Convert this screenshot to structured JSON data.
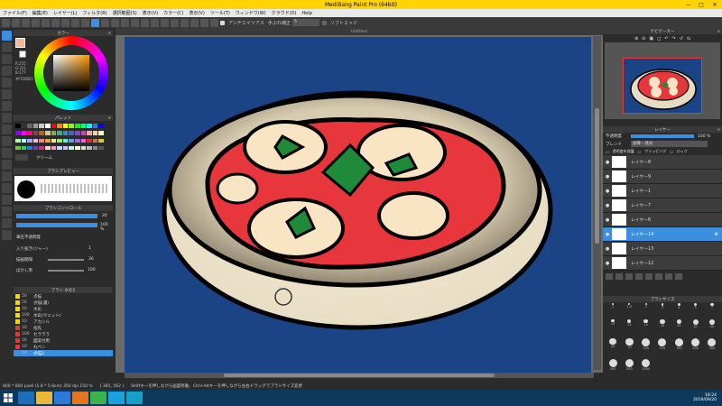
{
  "window": {
    "title": "MediBang Paint Pro (64bit)",
    "minimize": "—",
    "maximize": "□",
    "close": "✕"
  },
  "menu": [
    "ファイル(F)",
    "編集(E)",
    "レイヤー(L)",
    "フィルタ(R)",
    "選択範囲(S)",
    "表示(V)",
    "カラー(C)",
    "表示(V)",
    "ツール(T)",
    "ウィンドウ(W)",
    "クラウド(D)",
    "Help"
  ],
  "toolbar": {
    "antialias_label": "アンチエイリアス",
    "correction_label": "手ぶれ補正",
    "correction_value": "5",
    "soft_edge_label": "ソフトエッジ"
  },
  "color_panel": {
    "title": "カラー",
    "rgb": [
      "R:255",
      "G:221",
      "B:177"
    ],
    "hex": "#FFDDB1"
  },
  "palette_panel": {
    "title": "パレット",
    "palette_name": "クリーム"
  },
  "brush_preview": {
    "title": "ブラシプレビュー"
  },
  "brush_control": {
    "title": "ブラシコントロール",
    "size_value": "26",
    "opacity_value": "100 %",
    "opts": [
      {
        "label": "筆圧不透明度",
        "value": ""
      },
      {
        "label": "入り抜き(ジャー)",
        "value": "1"
      },
      {
        "label": "描画間隔",
        "value": "36"
      },
      {
        "label": "ぼかし率",
        "value": "100"
      }
    ]
  },
  "brush_list": {
    "title": "ブラシ 水彩2",
    "items": [
      {
        "n": "50",
        "name": "点描",
        "color": "#ffd400"
      },
      {
        "n": "50",
        "name": "点描(濃)",
        "color": "#ffd400"
      },
      {
        "n": "10",
        "name": "水彩",
        "color": "#ffd400"
      },
      {
        "n": "100",
        "name": "水彩(ウェット)",
        "color": "#ffd400"
      },
      {
        "n": "10",
        "name": "アカシル",
        "color": "#ffd400"
      },
      {
        "n": "10",
        "name": "指先",
        "color": "#e33"
      },
      {
        "n": "100",
        "name": "セラララ",
        "color": "#e33"
      },
      {
        "n": "16",
        "name": "図案付用",
        "color": "#e33"
      },
      {
        "n": "10",
        "name": "丸ペン",
        "color": "#e33"
      },
      {
        "n": "19",
        "name": "点描2",
        "color": "#3b8fe0"
      }
    ]
  },
  "canvas": {
    "tab": "Untitled"
  },
  "status": {
    "size": "800 * 800 pixel (5.8 * 5.8cm) 350 dpi 150 %",
    "coords": "( 381, 562 )",
    "hint": "Shiftキーを押しながら画面移動、Ctrl+Altキーを押しながら左右ドラッグでブラシサイズ変更"
  },
  "navigator": {
    "title": "ナビゲーター"
  },
  "layers_panel": {
    "title": "レイヤー",
    "opacity_label": "不透明度",
    "opacity_value": "100 %",
    "blend_label": "ブレンド",
    "blend_value": "加算・発光",
    "protect_label": "透明度を保護",
    "clipping_label": "クリッピング",
    "lock_label": "ロック",
    "layers": [
      {
        "name": "レイヤー8",
        "selected": false
      },
      {
        "name": "レイヤー9",
        "selected": false
      },
      {
        "name": "レイヤー1",
        "selected": false
      },
      {
        "name": "レイヤー7",
        "selected": false
      },
      {
        "name": "レイヤー6",
        "selected": false
      },
      {
        "name": "レイヤー14",
        "selected": true
      },
      {
        "name": "レイヤー13",
        "selected": false
      },
      {
        "name": "レイヤー12",
        "selected": false
      }
    ]
  },
  "brush_size": {
    "title": "ブラシサイズ",
    "sizes": [
      "1",
      "1.5",
      "2",
      "3",
      "4",
      "5",
      "7",
      "10",
      "12",
      "15",
      "20",
      "25",
      "30",
      "40",
      "50",
      "70",
      "100",
      "120",
      "150",
      "200",
      "300",
      "400",
      "500",
      "1000"
    ]
  },
  "taskbar": {
    "time": "18:24",
    "date": "2019/09/20"
  }
}
